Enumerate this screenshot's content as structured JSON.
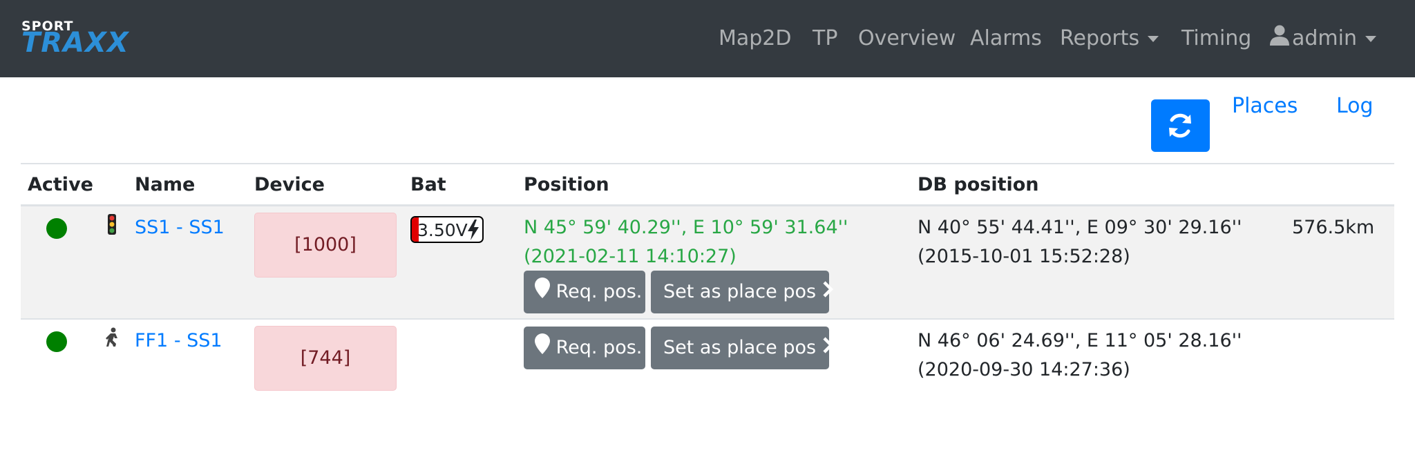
{
  "header": {
    "logo": {
      "top": "SPORT",
      "bottom": "TRAXX"
    },
    "nav": {
      "map2d": "Map2D",
      "tp": "TP",
      "overview": "Overview",
      "alarms": "Alarms",
      "reports": "Reports",
      "timing": "Timing",
      "user": "admin"
    }
  },
  "toolbar": {
    "places": "Places",
    "log": "Log",
    "refresh_icon": "refresh-icon"
  },
  "table": {
    "headers": {
      "active": "Active",
      "name": "Name",
      "device": "Device",
      "bat": "Bat",
      "position": "Position",
      "db_position": "DB position"
    },
    "buttons": {
      "req_pos": "Req. pos.",
      "set_place": "Set as place pos"
    },
    "rows": [
      {
        "active_color": "#008000",
        "status_icon": "traffic-light-icon",
        "name": "SS1 - SS1",
        "device": "[1000]",
        "battery": {
          "voltage": "3.50V",
          "level": 0.1,
          "charging_icon": "bolt-icon"
        },
        "position": {
          "line1": "N 45° 59' 40.29'', E 10° 59' 31.64''",
          "line2": "(2021-02-11 14:10:27)"
        },
        "db_position": {
          "line1": "N 40° 55' 44.41'', E 09° 30' 29.16''",
          "line2": "(2015-10-01 15:52:28)"
        },
        "distance": "576.5km"
      },
      {
        "active_color": "#008000",
        "status_icon": "runner-icon",
        "name": "FF1 - SS1",
        "device": "[744]",
        "db_position": {
          "line1": "N 46° 06' 24.69'', E 11° 05' 28.16''",
          "line2": "(2020-09-30 14:27:36)"
        }
      }
    ]
  }
}
